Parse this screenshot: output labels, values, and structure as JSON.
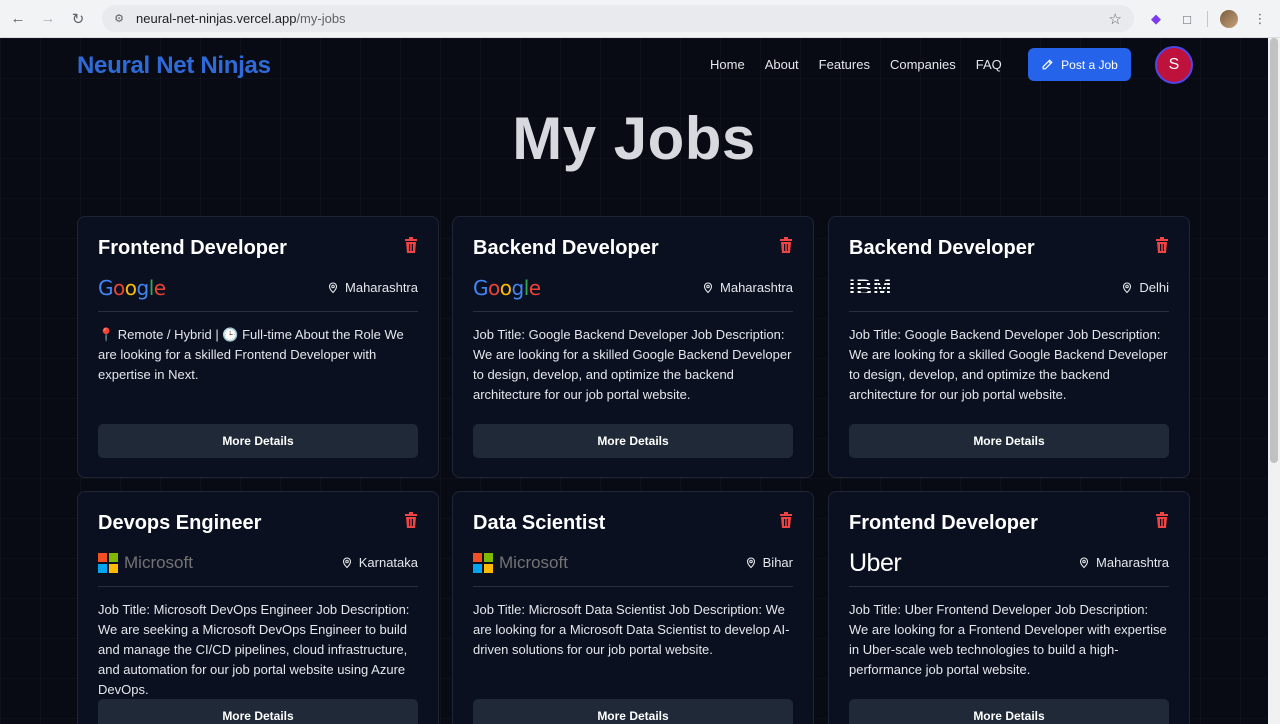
{
  "browser": {
    "url_host": "neural-net-ninjas.vercel.app",
    "url_path": "/my-jobs"
  },
  "nav": {
    "brand": "Neural Net Ninjas",
    "links": [
      "Home",
      "About",
      "Features",
      "Companies",
      "FAQ"
    ],
    "post_button": "Post a Job",
    "avatar_initial": "S"
  },
  "page_title": "My Jobs",
  "more_details_label": "More Details",
  "jobs": [
    {
      "title": "Frontend Developer",
      "company_logo": "Google",
      "location": "Maharashtra",
      "description": "📍 Remote / Hybrid | 🕒 Full-time About the Role We are looking for a skilled Frontend Developer with expertise in Next."
    },
    {
      "title": "Backend Developer",
      "company_logo": "Google",
      "location": "Maharashtra",
      "description": "Job Title: Google Backend Developer Job Description: We are looking for a skilled Google Backend Developer to design, develop, and optimize the backend architecture for our job portal website."
    },
    {
      "title": "Backend Developer",
      "company_logo": "IBM",
      "location": "Delhi",
      "description": "Job Title: Google Backend Developer Job Description: We are looking for a skilled Google Backend Developer to design, develop, and optimize the backend architecture for our job portal website."
    },
    {
      "title": "Devops Engineer",
      "company_logo": "Microsoft",
      "location": "Karnataka",
      "description": "Job Title: Microsoft DevOps Engineer Job Description: We are seeking a Microsoft DevOps Engineer to build and manage the CI/CD pipelines, cloud infrastructure, and automation for our job portal website using Azure DevOps."
    },
    {
      "title": "Data Scientist",
      "company_logo": "Microsoft",
      "location": "Bihar",
      "description": "Job Title: Microsoft Data Scientist Job Description: We are looking for a Microsoft Data Scientist to develop AI-driven solutions for our job portal website."
    },
    {
      "title": "Frontend Developer",
      "company_logo": "Uber",
      "location": "Maharashtra",
      "description": "Job Title: Uber Frontend Developer Job Description: We are looking for a Frontend Developer with expertise in Uber-scale web technologies to build a high-performance job portal website."
    }
  ],
  "colors": {
    "accent": "#2563eb",
    "brand": "#2f6bd8",
    "trash": "#ef4444",
    "avatar": "#be123c"
  }
}
